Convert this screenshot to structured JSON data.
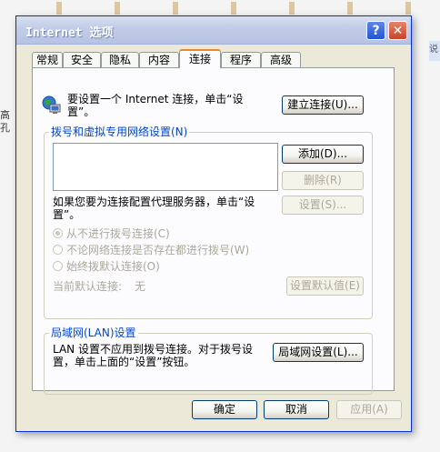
{
  "window": {
    "title": "Internet 选项",
    "help_label": "?",
    "close_label": "✕"
  },
  "tabs": [
    {
      "label": "常规"
    },
    {
      "label": "安全"
    },
    {
      "label": "隐私"
    },
    {
      "label": "内容"
    },
    {
      "label": "连接"
    },
    {
      "label": "程序"
    },
    {
      "label": "高级"
    }
  ],
  "active_tab": "连接",
  "setup": {
    "text_line1": "要设置一个 Internet 连接，单击“设",
    "text_line2": "置”。",
    "button_label": "建立连接(U)..."
  },
  "dialup": {
    "group_title": "拨号和虚拟专用网络设置(N)",
    "add_button": "添加(D)...",
    "delete_button": "删除(R)",
    "proxy_text_line1": "如果您要为连接配置代理服务器，单击“设",
    "proxy_text_line2": "置”。",
    "settings_button": "设置(S)...",
    "radio_never": "从不进行拨号连接(C)",
    "radio_when_no_network": "不论网络连接是否存在都进行拨号(W)",
    "radio_always": "始终拨默认连接(O)",
    "current_default_label": "当前默认连接:",
    "current_default_value": "无",
    "set_default_button": "设置默认值(E)"
  },
  "lan": {
    "group_title": "局域网(LAN)设置",
    "text_line1": "LAN 设置不应用到拨号连接。对于拨号设",
    "text_line2": "置，单击上面的“设置”按钮。",
    "button_label": "局域网设置(L)..."
  },
  "footer": {
    "ok": "确定",
    "cancel": "取消",
    "apply": "应用(A)"
  },
  "background": {
    "left_chars": "高\n孔",
    "right_char": "说"
  },
  "colors": {
    "accent": "#0046d5",
    "tab_highlight": "#e68b2c",
    "window_border": "#0831d9"
  }
}
